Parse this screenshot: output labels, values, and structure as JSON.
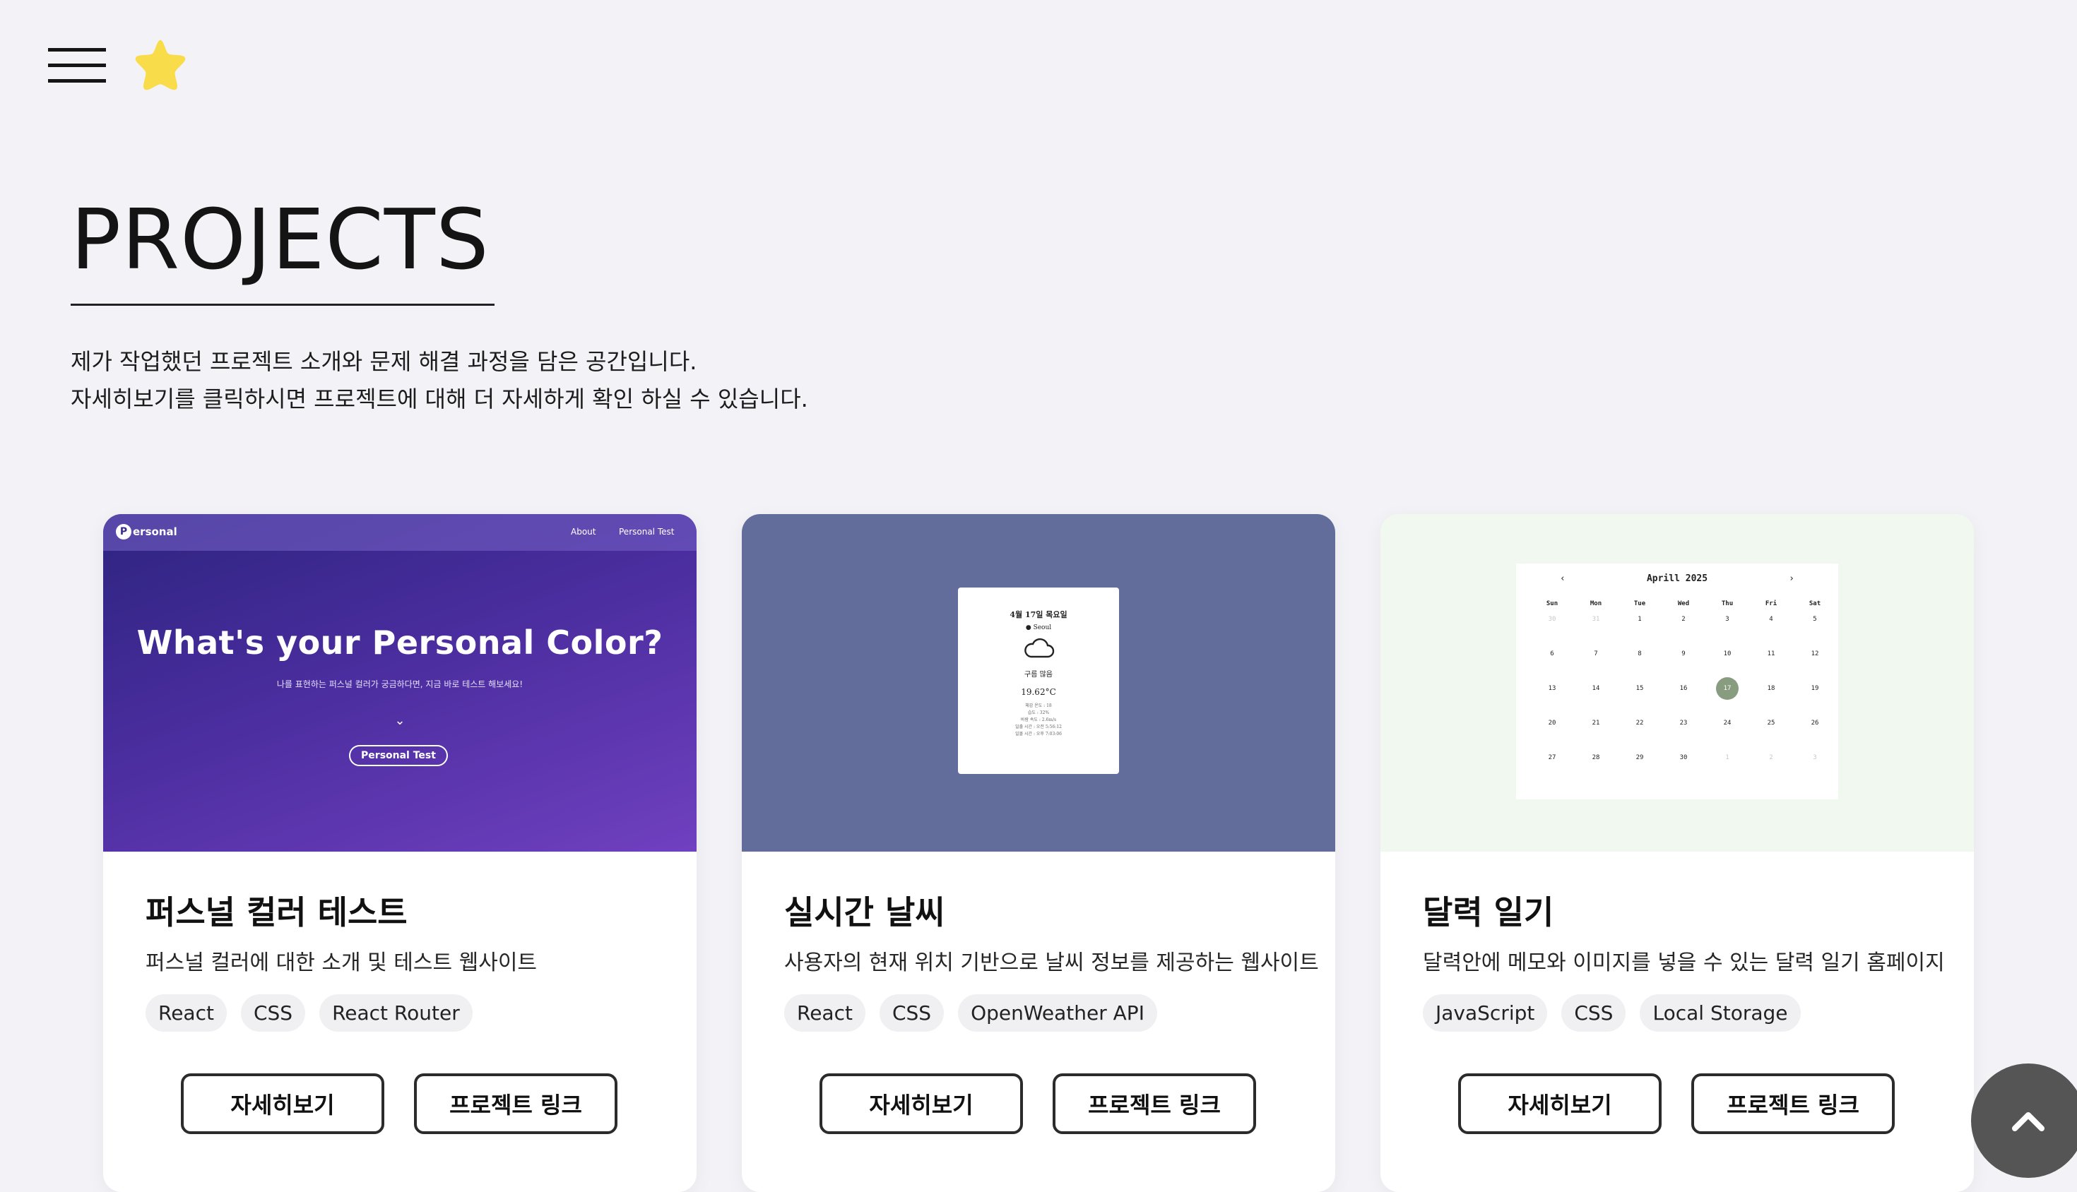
{
  "header": {
    "menu_icon": "hamburger-menu-icon",
    "logo_icon": "star-logo-icon",
    "star_color": "#F8DC4A"
  },
  "page": {
    "title": "PROJECTS",
    "intro_line1": "제가 작업했던 프로젝트 소개와 문제 해결 과정을 담은 공간입니다.",
    "intro_line2": "자세히보기를 클릭하시면 프로젝트에 대해 더 자세하게 확인 하실 수 있습니다."
  },
  "projects": [
    {
      "title": "퍼스널 컬러 테스트",
      "description": "퍼스널 컬러에 대한 소개 및 테스트 웹사이트",
      "tags": [
        "React",
        "CSS",
        "React Router"
      ],
      "detail_label": "자세히보기",
      "link_label": "프로젝트 링크",
      "preview": {
        "brand_initial": "P",
        "brand": "ersonal",
        "nav_about": "About",
        "nav_test": "Personal Test",
        "headline": "What's your Personal Color?",
        "subtext": "나를 표현하는 퍼스널 컬러가 궁금하다면, 지금 바로 테스트 해보세요!",
        "button": "Personal Test"
      }
    },
    {
      "title": "실시간 날씨",
      "description": "사용자의 현재 위치 기반으로 날씨 정보를 제공하는 웹사이트",
      "tags": [
        "React",
        "CSS",
        "OpenWeather API"
      ],
      "detail_label": "자세히보기",
      "link_label": "프로젝트 링크",
      "preview": {
        "date": "4월 17일 목요일",
        "location": "Seoul",
        "condition": "구름 많음",
        "temperature": "19.62°C",
        "detail_lines": [
          "체감 온도 : 18",
          "습도 : 32%",
          "바람 속도 : 2.6m/s",
          "일출 시간 : 오전 5:56:12",
          "일몰 시간 : 오후 7:03:06"
        ]
      }
    },
    {
      "title": "달력 일기",
      "description": "달력안에 메모와 이미지를 넣을 수 있는 달력 일기 홈페이지",
      "tags": [
        "JavaScript",
        "CSS",
        "Local Storage"
      ],
      "detail_label": "자세히보기",
      "link_label": "프로젝트 링크",
      "preview": {
        "month_label": "Aprill 2025",
        "prev": "‹",
        "next": "›",
        "weekdays": [
          "Sun",
          "Mon",
          "Tue",
          "Wed",
          "Thu",
          "Fri",
          "Sat"
        ],
        "days": [
          {
            "n": "30",
            "muted": true
          },
          {
            "n": "31",
            "muted": true
          },
          {
            "n": "1"
          },
          {
            "n": "2"
          },
          {
            "n": "3"
          },
          {
            "n": "4"
          },
          {
            "n": "5"
          },
          {
            "n": "6"
          },
          {
            "n": "7"
          },
          {
            "n": "8"
          },
          {
            "n": "9"
          },
          {
            "n": "10"
          },
          {
            "n": "11"
          },
          {
            "n": "12"
          },
          {
            "n": "13"
          },
          {
            "n": "14"
          },
          {
            "n": "15"
          },
          {
            "n": "16"
          },
          {
            "n": "17",
            "today": true
          },
          {
            "n": "18"
          },
          {
            "n": "19"
          },
          {
            "n": "20"
          },
          {
            "n": "21"
          },
          {
            "n": "22"
          },
          {
            "n": "23"
          },
          {
            "n": "24"
          },
          {
            "n": "25"
          },
          {
            "n": "26"
          },
          {
            "n": "27"
          },
          {
            "n": "28"
          },
          {
            "n": "29"
          },
          {
            "n": "30"
          },
          {
            "n": "1",
            "muted": true
          },
          {
            "n": "2",
            "muted": true
          },
          {
            "n": "3",
            "muted": true
          }
        ]
      }
    }
  ],
  "scroll_top": {
    "icon": "chevron-up-icon"
  }
}
